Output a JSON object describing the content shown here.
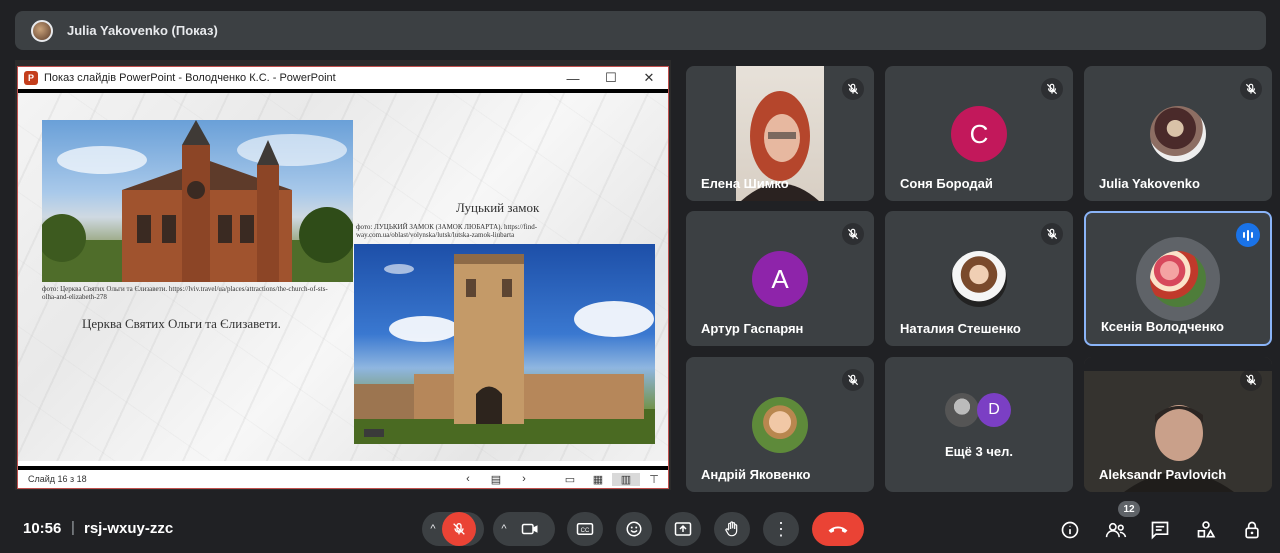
{
  "header": {
    "presenter_title": "Julia Yakovenko (Показ)"
  },
  "ppt": {
    "window_title": "Показ слайдів PowerPoint  -  Володченко К.С. - PowerPoint",
    "slide_counter": "Слайд 16 з 18",
    "caption_church": "фото: Церква Святих Ольги та Єлизавети. https://lviv.travel/ua/places/attractions/the-church-of-sts-olha-and-elizabeth-278",
    "title_church": "Церква Святих Ольги та Єлизавети.",
    "title_castle": "Луцький замок",
    "caption_castle": "фото: ЛУЦЬКИЙ ЗАМОК (ЗАМОК ЛЮБАРТА). https://find-way.com.ua/oblast/volynska/lutsk/lutska-zamok-liubarta"
  },
  "participants": [
    {
      "name": "Елена Шимко",
      "type": "video"
    },
    {
      "name": "Соня Бородай",
      "type": "letter",
      "letter": "C",
      "color": "#c2185b"
    },
    {
      "name": "Julia Yakovenko",
      "type": "photo"
    },
    {
      "name": "Артур Гаспарян",
      "type": "letter",
      "letter": "A",
      "color": "#8e24aa"
    },
    {
      "name": "Наталия Стешенко",
      "type": "photo"
    },
    {
      "name": "Ксенія Володченко",
      "type": "photo",
      "speaking": true
    },
    {
      "name": "Андрій Яковенко",
      "type": "photo"
    },
    {
      "name": "Ещё 3 чел.",
      "type": "group",
      "letter": "D"
    },
    {
      "name": "Aleksandr Pavlovich",
      "type": "video"
    }
  ],
  "meeting": {
    "time": "10:56",
    "code": "rsj-wxuy-zzc",
    "participant_count": "12"
  },
  "colors": {
    "background": "#202124",
    "tile": "#3c4043",
    "end_call": "#ea4335",
    "speaking": "#8ab4f8"
  },
  "icons": [
    "mic-off-icon",
    "camera-icon",
    "captions-icon",
    "emoji-icon",
    "present-icon",
    "raise-hand-icon",
    "more-icon",
    "end-call-icon",
    "info-icon",
    "people-icon",
    "chat-icon",
    "activities-icon",
    "host-controls-icon"
  ]
}
